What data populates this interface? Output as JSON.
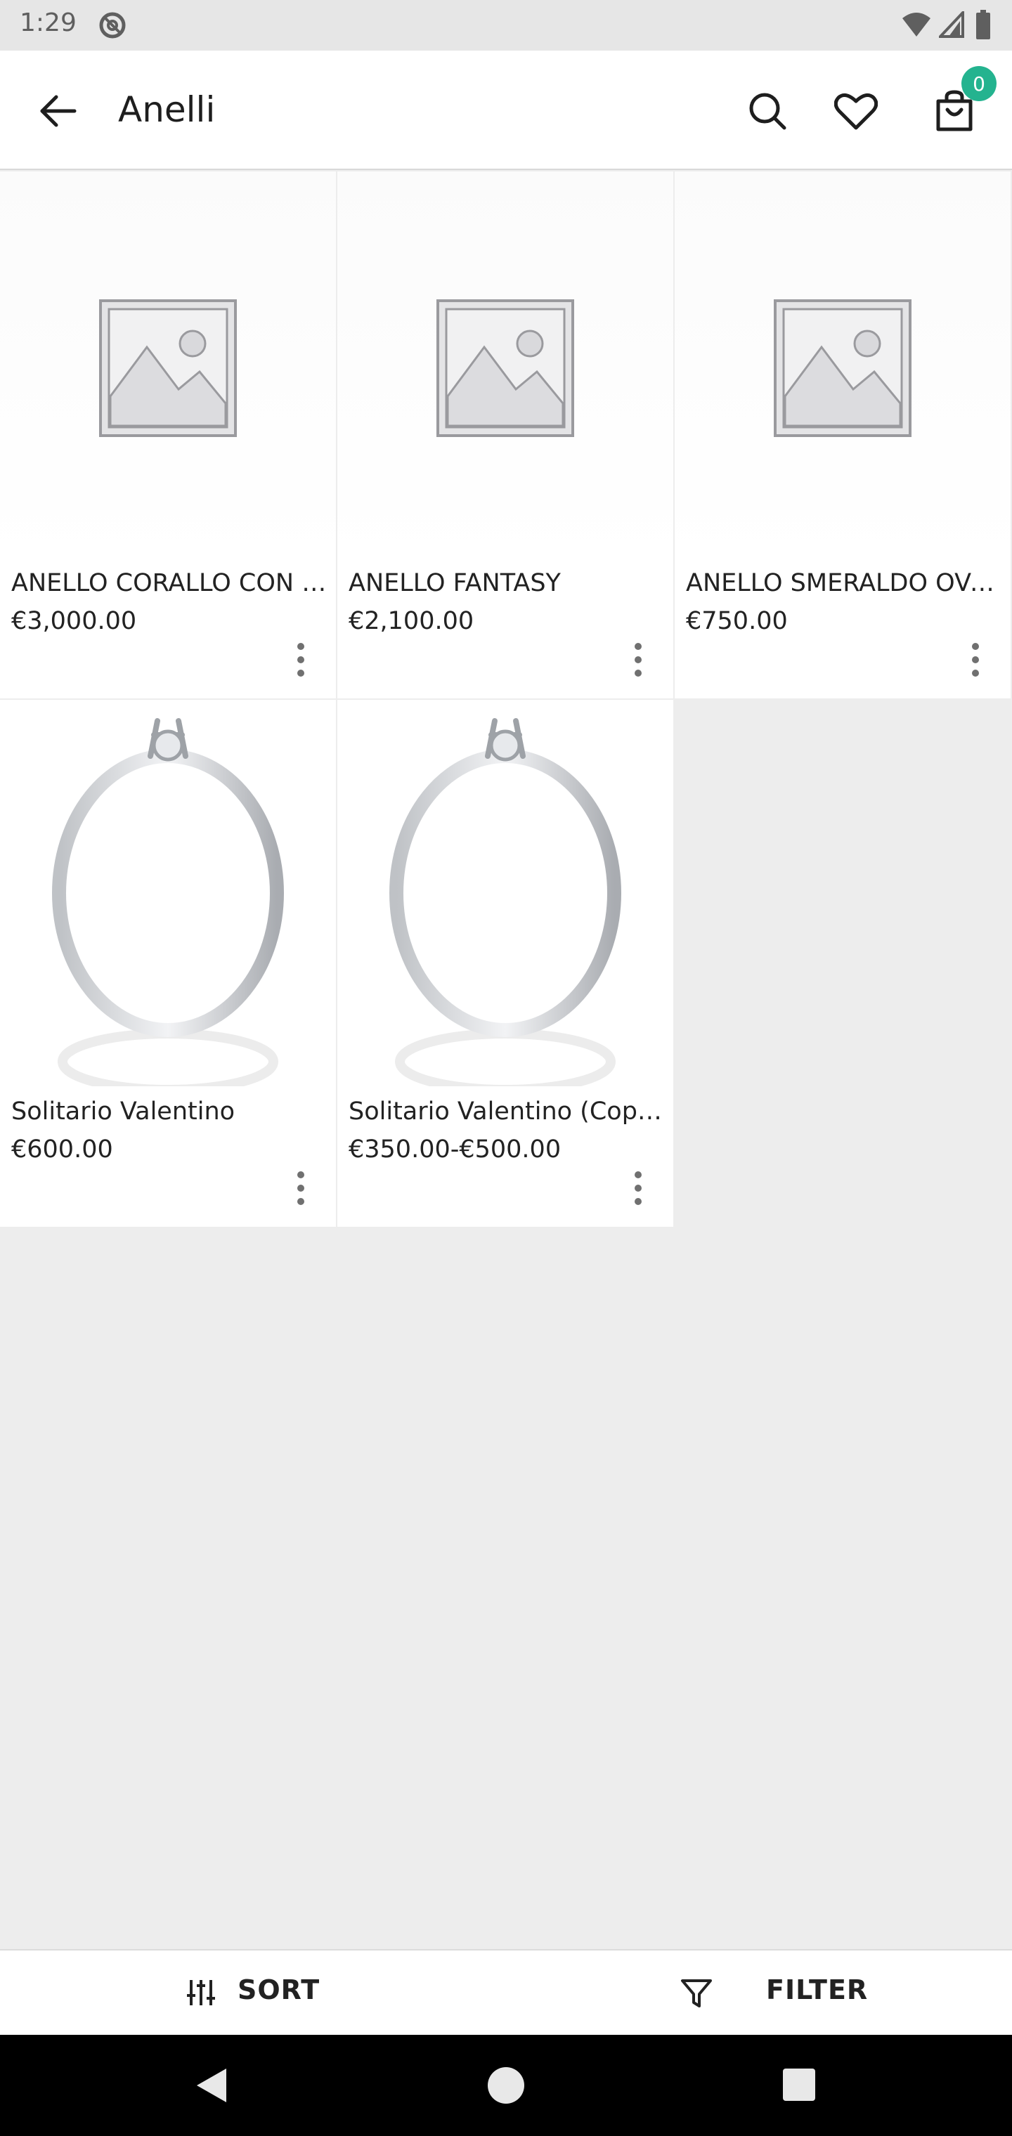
{
  "status_bar": {
    "time": "1:29"
  },
  "app_bar": {
    "title": "Anelli",
    "cart_count": "0"
  },
  "products": [
    {
      "name": "ANELLO CORALLO CON SMERALDI",
      "price": "€3,000.00",
      "image": "placeholder"
    },
    {
      "name": "ANELLO FANTASY",
      "price": "€2,100.00",
      "image": "placeholder"
    },
    {
      "name": "ANELLO SMERALDO OVALE",
      "price": "€750.00",
      "image": "placeholder"
    },
    {
      "name": "Solitario Valentino",
      "price": "€600.00",
      "image": "ring"
    },
    {
      "name": "Solitario Valentino (Copia)",
      "price": "€350.00-€500.00",
      "image": "ring"
    }
  ],
  "bottom_bar": {
    "sort_label": "SORT",
    "filter_label": "FILTER"
  },
  "colors": {
    "badge": "#24b38f",
    "background": "#ededed"
  }
}
